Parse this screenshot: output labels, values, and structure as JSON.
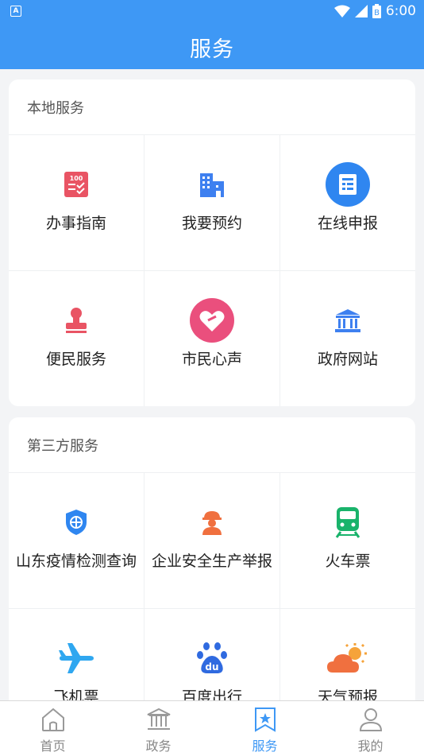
{
  "status_bar": {
    "indicator": "A",
    "time": "6:00",
    "battery_level": "B"
  },
  "header": {
    "title": "服务"
  },
  "local_services": {
    "title": "本地服务",
    "items": [
      {
        "label": "办事指南",
        "icon": "checklist-icon"
      },
      {
        "label": "我要预约",
        "icon": "building-icon"
      },
      {
        "label": "在线申报",
        "icon": "document-icon"
      },
      {
        "label": "便民服务",
        "icon": "stamp-icon"
      },
      {
        "label": "市民心声",
        "icon": "heart-icon"
      },
      {
        "label": "政府网站",
        "icon": "government-building-icon"
      }
    ]
  },
  "third_party_services": {
    "title": "第三方服务",
    "items": [
      {
        "label": "山东疫情检测查询",
        "icon": "shield-icon"
      },
      {
        "label": "企业安全生产举报",
        "icon": "worker-icon"
      },
      {
        "label": "火车票",
        "icon": "train-icon"
      },
      {
        "label": "飞机票",
        "icon": "airplane-icon"
      },
      {
        "label": "百度出行",
        "icon": "baidu-icon"
      },
      {
        "label": "天气预报",
        "icon": "weather-icon"
      }
    ]
  },
  "tabbar": {
    "tabs": [
      {
        "label": "首页",
        "icon": "home-icon"
      },
      {
        "label": "政务",
        "icon": "government-icon"
      },
      {
        "label": "服务",
        "icon": "service-icon"
      },
      {
        "label": "我的",
        "icon": "user-icon"
      }
    ],
    "active": "服务"
  },
  "colors": {
    "primary": "#3e98f5",
    "red": "#e95464",
    "orange": "#f0703f",
    "green": "#19b36b"
  }
}
